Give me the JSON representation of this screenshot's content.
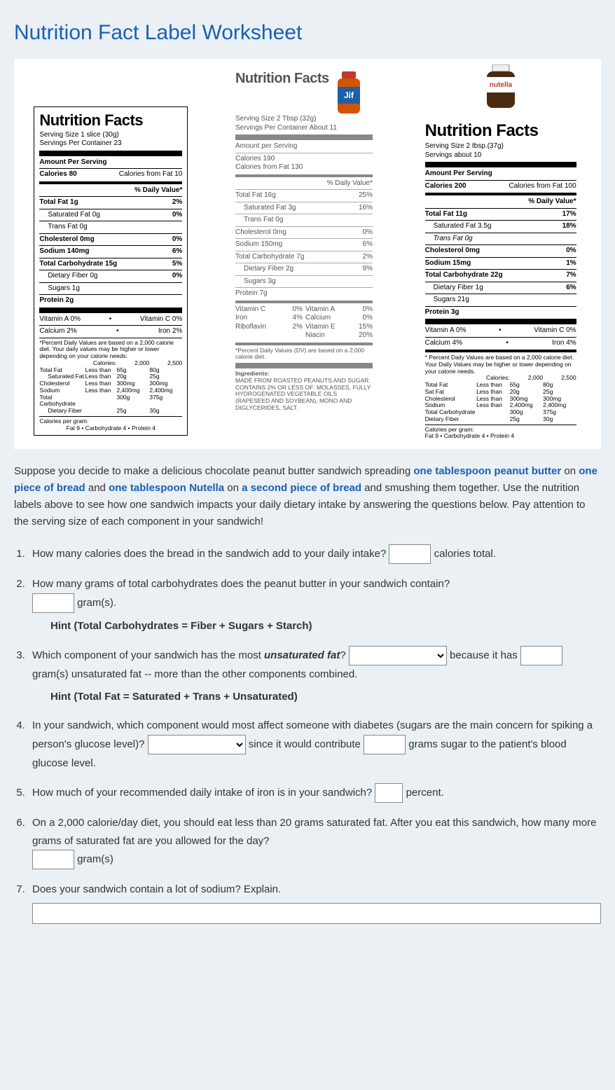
{
  "title": "Nutrition Fact Label Worksheet",
  "scenario": {
    "t0": "Suppose you decide to make a delicious chocolate peanut butter sandwich spreading ",
    "e0": "one tablespoon peanut butter",
    "t1": " on ",
    "e1": "one piece of bread",
    "t2": " and ",
    "e2": "one tablespoon Nutella",
    "t3": " on ",
    "e3": "a second piece of bread",
    "t4": " and smushing them together.  Use the nutrition labels above to see how one sandwich impacts your daily dietary intake by answering the questions below.  Pay attention to the serving size of each component in your sandwich!"
  },
  "bread": {
    "title": "Nutrition Facts",
    "serving": "Serving Size 1 slice (30g)",
    "servings": "Servings Per Container 23",
    "aps": "Amount Per Serving",
    "cal_l": "Calories 80",
    "cal_r": "Calories from Fat 10",
    "dv": "% Daily Value*",
    "tf_l": "Total Fat 1g",
    "tf_r": "2%",
    "sf_l": "Saturated Fat 0g",
    "sf_r": "0%",
    "trf": "Trans Fat 0g",
    "ch_l": "Cholesterol 0mg",
    "ch_r": "0%",
    "so_l": "Sodium 140mg",
    "so_r": "6%",
    "tc_l": "Total Carbohydrate 15g",
    "tc_r": "5%",
    "df_l": "Dietary Fiber 0g",
    "df_r": "0%",
    "su": "Sugars 1g",
    "pr": "Protein 2g",
    "va": "Vitamin A 0%",
    "vc": "Vitamin C 0%",
    "ca": "Calcium 2%",
    "fe": "Iron 2%",
    "note": "*Percent Daily Values are based on a 2,000 calorie diet. Your daily values may be higher or lower depending on your calorie needs:",
    "tbl_h": "Calories:",
    "tbl_2k": "2,000",
    "tbl_25": "2,500",
    "t1a": "Total Fat",
    "t1b": "Less than",
    "t1c": "65g",
    "t1d": "80g",
    "t2a": "Saturated Fat",
    "t2b": "Less than",
    "t2c": "20g",
    "t2d": "25g",
    "t3a": "Cholesterol",
    "t3b": "Less than",
    "t3c": "300mg",
    "t3d": "300mg",
    "t4a": "Sodium",
    "t4b": "Less than",
    "t4c": "2,400mg",
    "t4d": "2,400mg",
    "t5a": "Total Carbohydrate",
    "t5c": "300g",
    "t5d": "375g",
    "t6a": "Dietary Fiber",
    "t6c": "25g",
    "t6d": "30g",
    "cpg": "Calories per gram:",
    "cpg2": "Fat 9  •  Carbohydrate 4  •  Protein 4"
  },
  "jif": {
    "title": "Nutrition Facts",
    "serving": "Serving Size 2 Tbsp (32g)",
    "servings": "Servings Per Container About 11",
    "aps": "Amount per Serving",
    "cal": "Calories 190",
    "cff": "Calories from Fat 130",
    "dv": "% Daily Value*",
    "tf_l": "Total Fat 16g",
    "tf_r": "25%",
    "sf_l": "Saturated Fat 3g",
    "sf_r": "16%",
    "trf": "Trans Fat 0g",
    "ch_l": "Cholesterol 0mg",
    "ch_r": "0%",
    "so_l": "Sodium 150mg",
    "so_r": "6%",
    "tc_l": "Total Carbohydrate 7g",
    "tc_r": "2%",
    "df_l": "Dietary Fiber 2g",
    "df_r": "9%",
    "su": "Sugars 3g",
    "pr": "Protein 7g",
    "vc_l": "Vitamin C",
    "vc_r": "0%",
    "va_l": "Vitamin A",
    "va_r": "0%",
    "fe_l": "Iron",
    "fe_r": "4%",
    "ca_l": "Calcium",
    "ca_r": "0%",
    "rb_l": "Riboflavin",
    "rb_r": "2%",
    "ve_l": "Vitamin E",
    "ve_r": "15%",
    "ni_l": "Niacin",
    "ni_r": "20%",
    "note": "*Percent Daily Values (DV) are based on a 2,000 calorie diet.",
    "ing_h": "Ingredients:",
    "ing": "MADE FROM ROASTED PEANUTS AND SUGAR. CONTAINS 2% OR LESS OF: MOLASSES, FULLY HYDROGENATED VEGETABLE OILS (RAPESEED AND SOYBEAN), MONO AND DIGLYCERIDES, SALT."
  },
  "nutella": {
    "title": "Nutrition Facts",
    "serving": "Serving Size 2 tbsp.(37g)",
    "servings": "Servings about 10",
    "aps": "Amount Per Serving",
    "cal_l": "Calories 200",
    "cal_r": "Calories from Fat 100",
    "dv": "% Daily Value*",
    "tf_l": "Total Fat 11g",
    "tf_r": "17%",
    "sf_l": "Saturated Fat 3.5g",
    "sf_r": "18%",
    "trf": "Trans Fat 0g",
    "ch_l": "Cholesterol 0mg",
    "ch_r": "0%",
    "so_l": "Sodium 15mg",
    "so_r": "1%",
    "tc_l": "Total Carbohydrate 22g",
    "tc_r": "7%",
    "df_l": "Dietary Fiber 1g",
    "df_r": "6%",
    "su": "Sugars 21g",
    "pr": "Protein 3g",
    "va": "Vitamin A  0%",
    "vc": "Vitamin C 0%",
    "ca": "Calcium   4%",
    "fe": "Iron 4%",
    "note": "* Percent Daily Values are based on a 2,000 calorie diet. Your Daily Values may be higher or lower depending on your calorie needs.",
    "tbl_h": "Calories:",
    "tbl_2k": "2,000",
    "tbl_25": "2,500",
    "t1a": "Total Fat",
    "t1b": "Less than",
    "t1c": "65g",
    "t1d": "80g",
    "t2a": "Sat Fat",
    "t2b": "Less than",
    "t2c": "20g",
    "t2d": "25g",
    "t3a": "Cholesterol",
    "t3b": "Less than",
    "t3c": "300mg",
    "t3d": "300mg",
    "t4a": "Sodium",
    "t4b": "Less than",
    "t4c": "2,400mg",
    "t4d": "2,400mg",
    "t5a": "Total Carbohydrate",
    "t5c": "300g",
    "t5d": "375g",
    "t6a": "Dietary Fiber",
    "t6c": "25g",
    "t6d": "30g",
    "cpg": "Calories per gram:",
    "cpg2": "Fat 9     •     Carbohydrate 4     •     Protein 4"
  },
  "q": {
    "q1a": "How many calories does the bread in the sandwich add to your daily intake? ",
    "q1b": " calories total.",
    "q2a": "How many grams of total carbohydrates does the peanut butter in your sandwich contain? ",
    "q2b": " gram(s).",
    "q2h": "Hint (Total Carbohydrates = Fiber + Sugars + Starch)",
    "q3a": "Which component of your sandwich has the most ",
    "q3ae": "unsaturated fat",
    "q3b": "?  ",
    "q3c": " because it has ",
    "q3d": " gram(s) unsaturated fat -- more than the other components combined.",
    "q3h": "Hint (Total Fat = Saturated + Trans + Unsaturated)",
    "q4a": "In your sandwich, which component would most affect someone with diabetes (sugars are the main concern for spiking a person's glucose level)? ",
    "q4b": " since it would contribute ",
    "q4c": " grams sugar to the patient's blood glucose level.",
    "q5a": "How much of your recommended daily intake of iron is in your sandwich? ",
    "q5b": " percent.",
    "q6a": "On a 2,000 calorie/day diet, you should eat less than 20 grams saturated fat.  After you eat this sandwich, how many more grams of saturated fat are you allowed for the day?  ",
    "q6b": " gram(s)",
    "q7": "Does your sandwich contain a lot of sodium?  Explain."
  }
}
